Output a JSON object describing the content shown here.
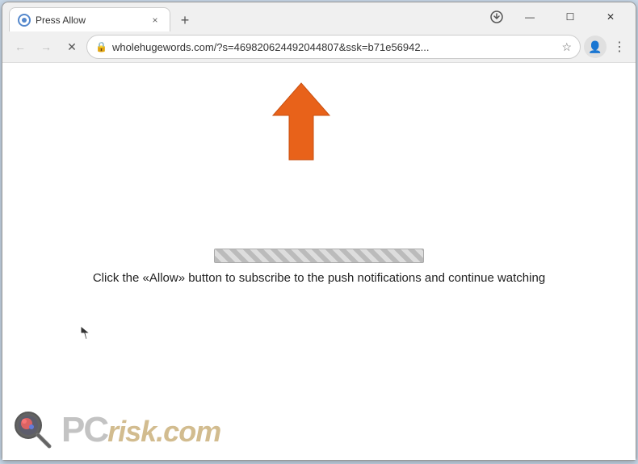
{
  "window": {
    "title": "Press Allow",
    "url": "wholehugewords.com/?s=469820624492044807&ssk=b71e56942...",
    "url_full": "wholehugewords.com/?s=469820624492044807&ssk=b71e56942...",
    "tab_close_label": "×",
    "new_tab_label": "+"
  },
  "nav": {
    "back_label": "←",
    "forward_label": "→",
    "reload_label": "✕"
  },
  "controls": {
    "minimize": "—",
    "maximize": "☐",
    "close": "✕"
  },
  "content": {
    "main_text": "Click the «Allow» button to subscribe to the push notifications and continue watching",
    "progress_bar_aria": "Loading progress bar"
  },
  "watermark": {
    "brand": "PC",
    "brand_italic": "risk.com"
  },
  "icons": {
    "lock": "🔒",
    "star": "☆",
    "profile": "👤",
    "more": "⋮",
    "favicon_loading": "C",
    "chrome_menu": "⋮"
  }
}
